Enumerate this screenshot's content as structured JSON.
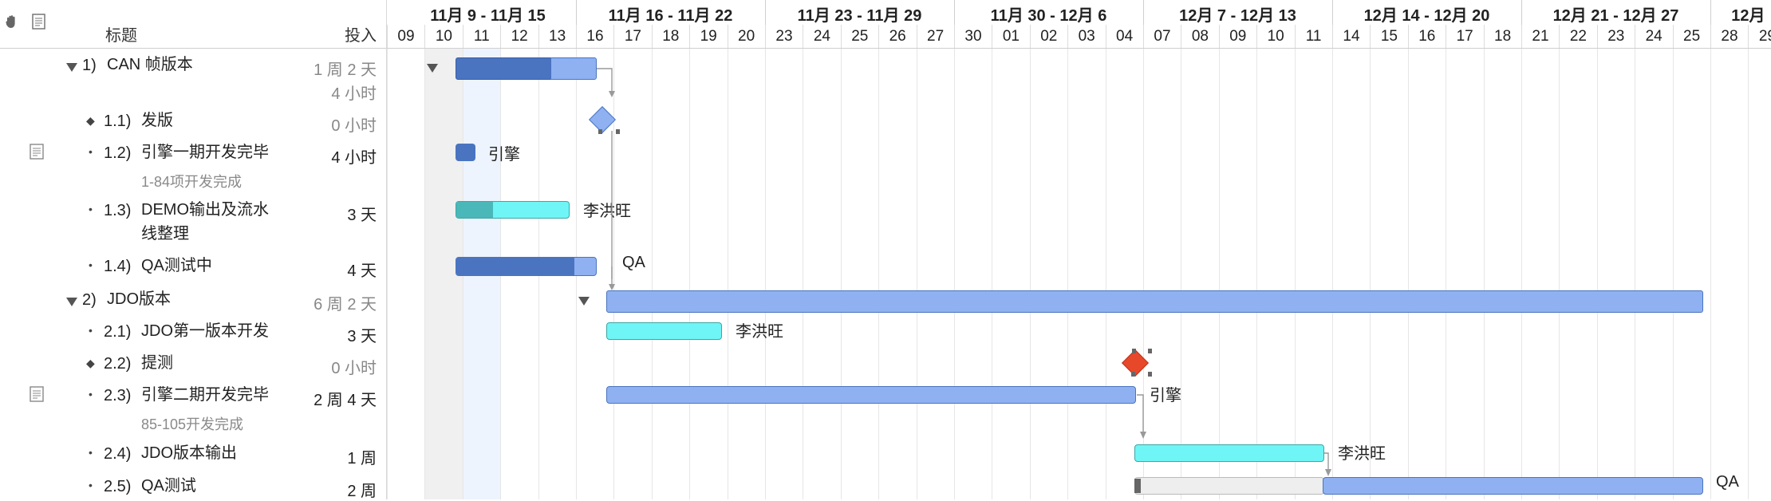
{
  "outline": {
    "header": {
      "title": "标题",
      "effort": "投入"
    },
    "toolbar": {
      "icons": [
        "hand-icon",
        "note-icon"
      ]
    },
    "rows": [
      {
        "num": "1)",
        "title": "CAN 帧版本",
        "effort": "1 周 2 天",
        "effort2": "4 小时",
        "group": true,
        "effort_gray": true
      },
      {
        "num": "1.1)",
        "title": "发版",
        "effort": "0 小时",
        "bullet": "◆",
        "effort_gray": true
      },
      {
        "num": "1.2)",
        "title": "引擎一期开发完毕",
        "effort": "4 小时",
        "bullet": "•",
        "note": "1-84项开发完成",
        "has_note": true
      },
      {
        "num": "1.3)",
        "title": "DEMO输出及流水",
        "title2": "线整理",
        "effort": "3 天",
        "bullet": "•"
      },
      {
        "num": "1.4)",
        "title": "QA测试中",
        "effort": "4 天",
        "bullet": "•"
      },
      {
        "num": "2)",
        "title": "JDO版本",
        "effort": "6 周 2 天",
        "group": true,
        "effort_gray": true
      },
      {
        "num": "2.1)",
        "title": "JDO第一版本开发",
        "effort": "3 天",
        "bullet": "•"
      },
      {
        "num": "2.2)",
        "title": "提测",
        "effort": "0 小时",
        "bullet": "◆",
        "effort_gray": true
      },
      {
        "num": "2.3)",
        "title": "引擎二期开发完毕",
        "effort": "2 周 4 天",
        "bullet": "•",
        "note": "85-105开发完成",
        "has_note": true
      },
      {
        "num": "2.4)",
        "title": "JDO版本输出",
        "effort": "1 周",
        "bullet": "•"
      },
      {
        "num": "2.5)",
        "title": "QA测试",
        "effort": "2 周",
        "bullet": "•"
      }
    ]
  },
  "gantt": {
    "weeks": [
      "11月 9 - 11月 15",
      "11月 16 - 11月 22",
      "11月 23 - 11月 29",
      "11月 30 - 12月 6",
      "12月 7 - 12月 13",
      "12月 14 - 12月 20",
      "12月 21 - 12月 27",
      "12月"
    ],
    "days": [
      "09",
      "10",
      "11",
      "12",
      "13",
      "16",
      "17",
      "18",
      "19",
      "20",
      "23",
      "24",
      "25",
      "26",
      "27",
      "30",
      "01",
      "02",
      "03",
      "04",
      "07",
      "08",
      "09",
      "10",
      "11",
      "14",
      "15",
      "16",
      "17",
      "18",
      "21",
      "22",
      "23",
      "24",
      "25",
      "28",
      "29"
    ],
    "labels": {
      "r1_2": "引擎",
      "r1_3": "李洪旺",
      "r1_4": "QA",
      "r2_1": "李洪旺",
      "r2_3": "引擎",
      "r2_4": "李洪旺",
      "r2_5": "QA"
    },
    "colors": {
      "dark_blue": "#4a74c0",
      "light_blue": "#8fb1f2",
      "cyan": "#6ff5f5",
      "teal": "#4ab8b8",
      "milestone_blue": "#8fb1f2",
      "milestone_red": "#e8482a",
      "weekend": "#f0f0f0",
      "today": "#eef4fd"
    }
  }
}
